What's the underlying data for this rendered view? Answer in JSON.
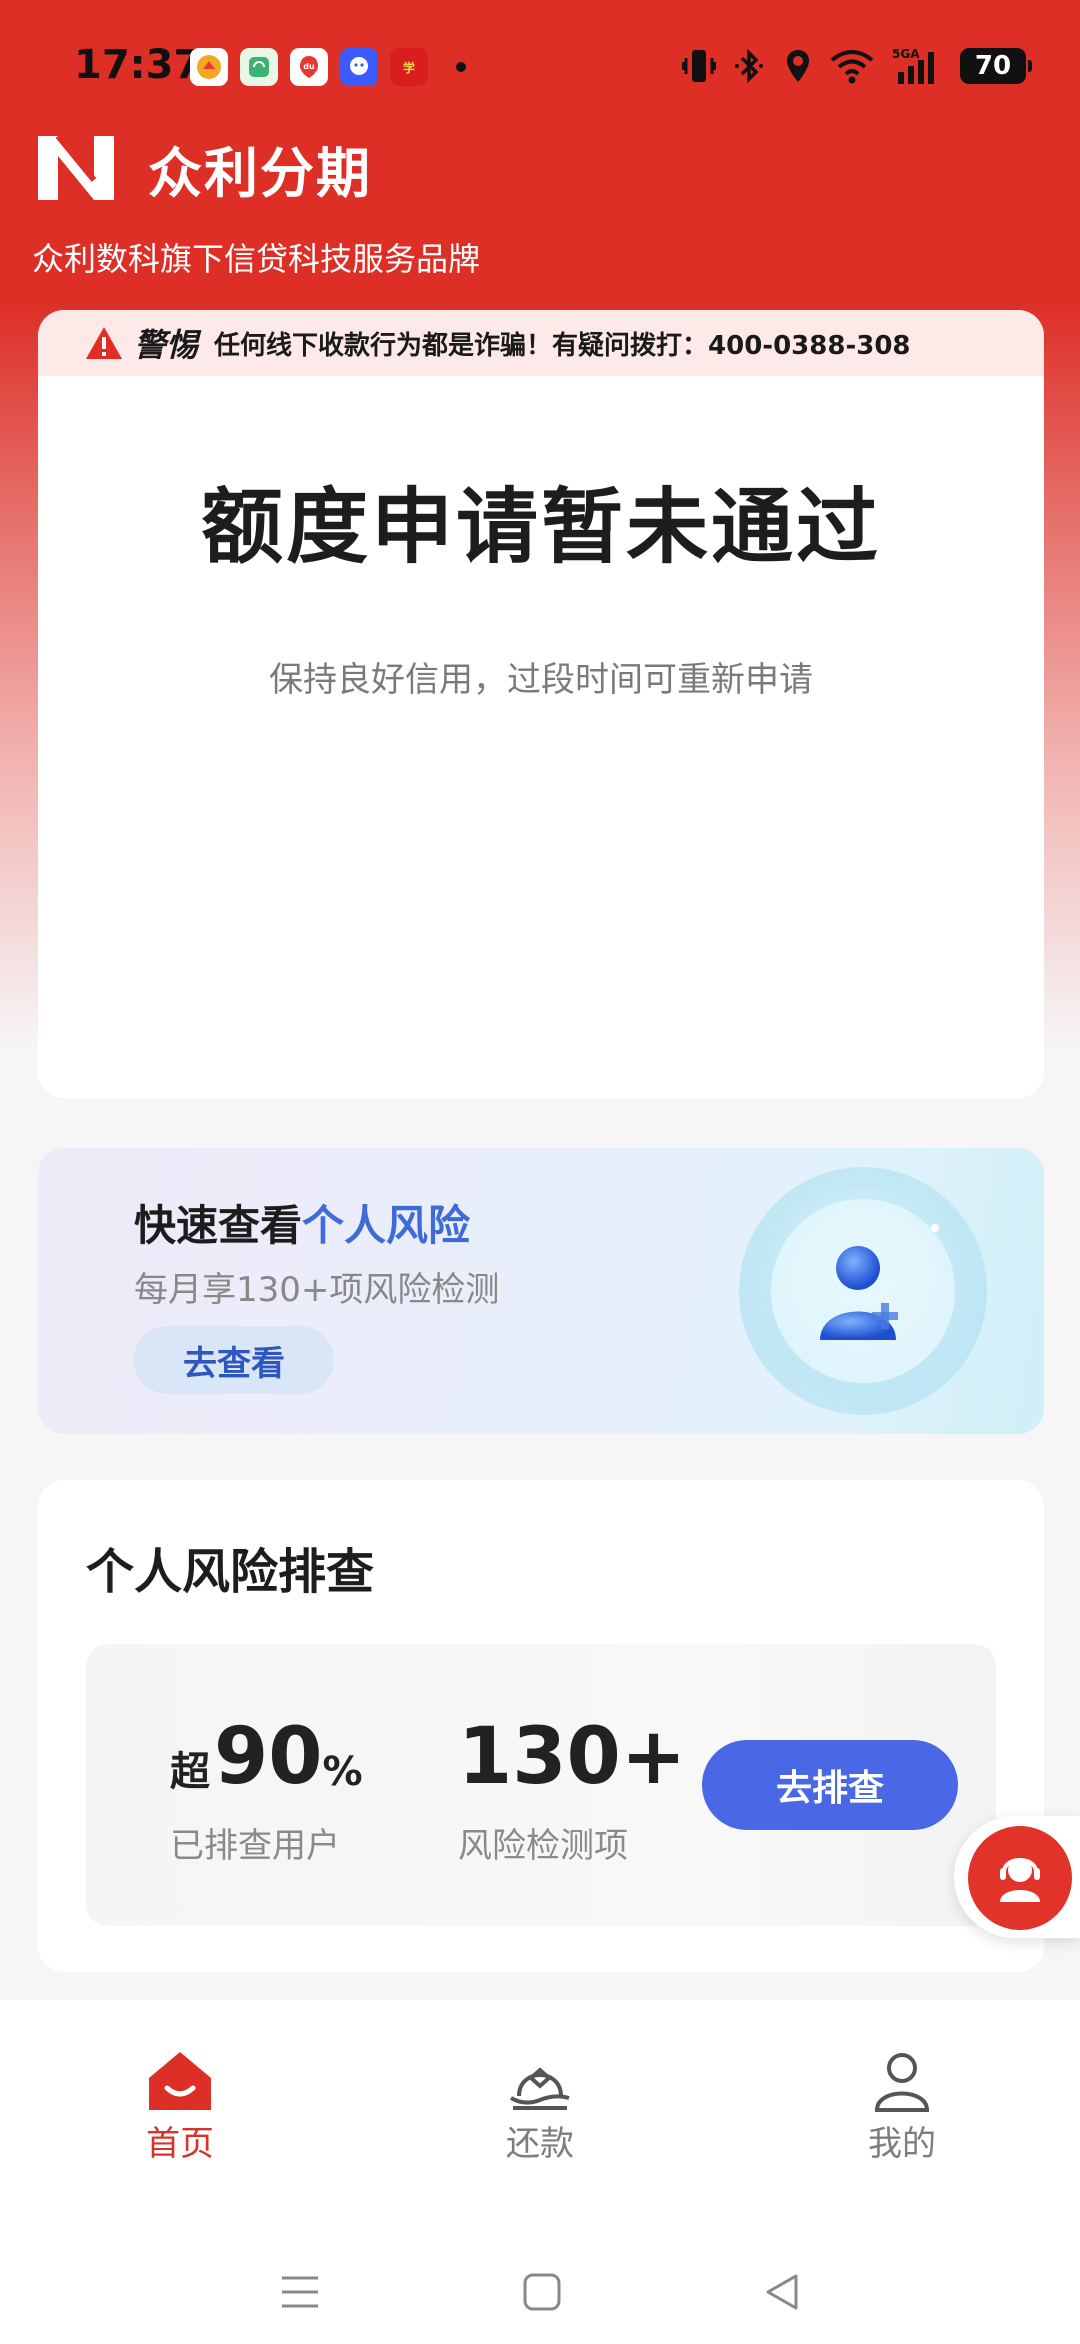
{
  "status_bar": {
    "time": "17:37",
    "notification_apps": [
      "sparkle-app",
      "share-app",
      "du-app",
      "qq-app",
      "study-app"
    ],
    "battery": "70",
    "signal_label": "5GA"
  },
  "brand": {
    "name": "众利分期",
    "subtitle": "众利数科旗下信贷科技服务品牌"
  },
  "warning": {
    "title": "警惕",
    "text": "任何线下收款行为都是诈骗！有疑问拨打：400-0388-308"
  },
  "result": {
    "title": "额度申请暂未通过",
    "subtitle": "保持良好信用，过段时间可重新申请"
  },
  "risk_banner": {
    "title_prefix": "快速查看",
    "title_highlight": "个人风险",
    "desc": "每月享130+项风险检测",
    "button": "去查看"
  },
  "risk_check": {
    "title": "个人风险排查",
    "stat1_prefix": "超",
    "stat1_value": "90",
    "stat1_suffix": "%",
    "stat1_label": "已排查用户",
    "stat2_value": "130+",
    "stat2_label": "风险检测项",
    "button": "去排查"
  },
  "tabs": [
    {
      "label": "首页",
      "icon": "home-icon",
      "active": true
    },
    {
      "label": "还款",
      "icon": "repay-icon",
      "active": false
    },
    {
      "label": "我的",
      "icon": "profile-icon",
      "active": false
    }
  ],
  "colors": {
    "brand_red": "#dd2f26",
    "accent_blue": "#4a68e6",
    "highlight_blue": "#3d6cd9"
  }
}
